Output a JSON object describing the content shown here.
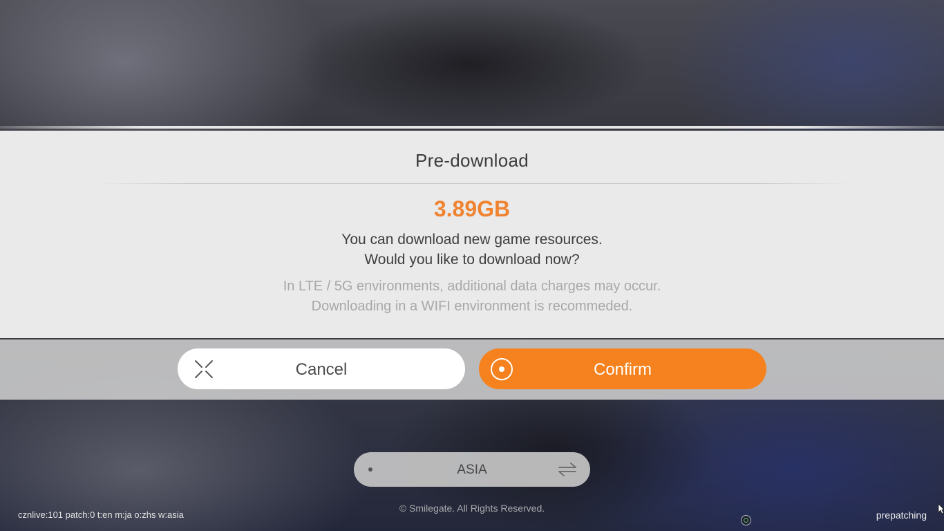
{
  "dialog": {
    "title": "Pre-download",
    "size": "3.89GB",
    "message_line1": "You can download new game resources.",
    "message_line2": "Would you like to download now?",
    "note_line1": "In LTE / 5G environments, additional data charges may occur.",
    "note_line2": "Downloading in a WIFI environment is recommeded.",
    "accent_color": "#f5821f"
  },
  "buttons": {
    "cancel": {
      "label": "Cancel",
      "icon": "close-x-icon"
    },
    "confirm": {
      "label": "Confirm",
      "icon": "target-circle-icon"
    }
  },
  "region": {
    "label": "ASIA",
    "icon": "swap-arrows-icon"
  },
  "footer": {
    "debug_info": "cznlive:101 patch:0 t:en m:ja o:zhs w:asia",
    "copyright": "© Smilegate. All Rights Reserved.",
    "status": "prepatching"
  }
}
